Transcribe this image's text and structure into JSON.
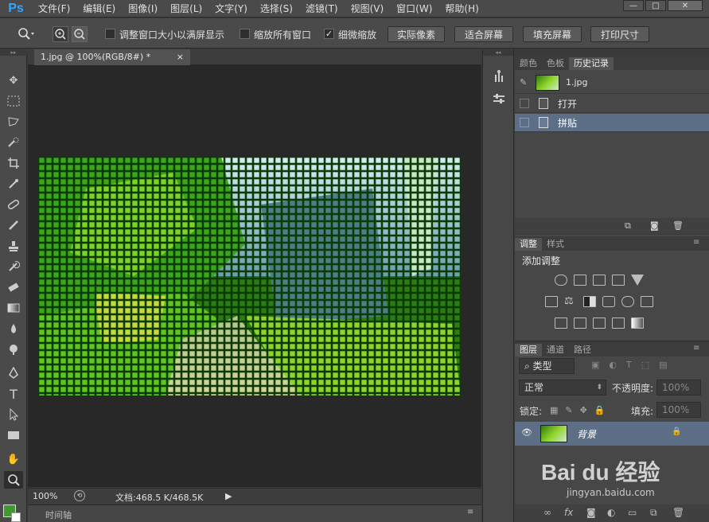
{
  "app": {
    "logo": "Ps"
  },
  "menu": [
    "文件(F)",
    "编辑(E)",
    "图像(I)",
    "图层(L)",
    "文字(Y)",
    "选择(S)",
    "滤镜(T)",
    "视图(V)",
    "窗口(W)",
    "帮助(H)"
  ],
  "window_controls": {
    "minimize": "—",
    "restore": "□",
    "close": "✕"
  },
  "options": {
    "resize_windows_label": "调整窗口大小以满屏显示",
    "zoom_all_label": "缩放所有窗口",
    "scrubby_zoom_label": "细微缩放",
    "scrubby_checked": "✓",
    "actual_pixels": "实际像素",
    "fit_screen": "适合屏幕",
    "fill_screen": "填充屏幕",
    "print_size": "打印尺寸"
  },
  "document": {
    "tab_title": "1.jpg @ 100%(RGB/8#) *",
    "tab_close": "×"
  },
  "status": {
    "zoom": "100%",
    "doc_info": "文档:468.5 K/468.5K",
    "arrow": "▶"
  },
  "timeline": {
    "label": "时间轴"
  },
  "history_panel": {
    "tabs": [
      "颜色",
      "色板",
      "历史记录"
    ],
    "snapshot_name": "1.jpg",
    "steps": [
      "打开",
      "拼贴"
    ]
  },
  "adjustments_panel": {
    "tabs": [
      "调整",
      "样式"
    ],
    "heading": "添加调整"
  },
  "layers_panel": {
    "tabs": [
      "图层",
      "通道",
      "路径"
    ],
    "filter": "类型",
    "blend_mode": "正常",
    "opacity_label": "不透明度:",
    "opacity_value": "100%",
    "lock_label": "锁定:",
    "fill_label": "填充:",
    "fill_value": "100%",
    "layer_name": "背景"
  },
  "watermark": {
    "brand": "Bai du 经验",
    "url": "jingyan.baidu.com"
  }
}
